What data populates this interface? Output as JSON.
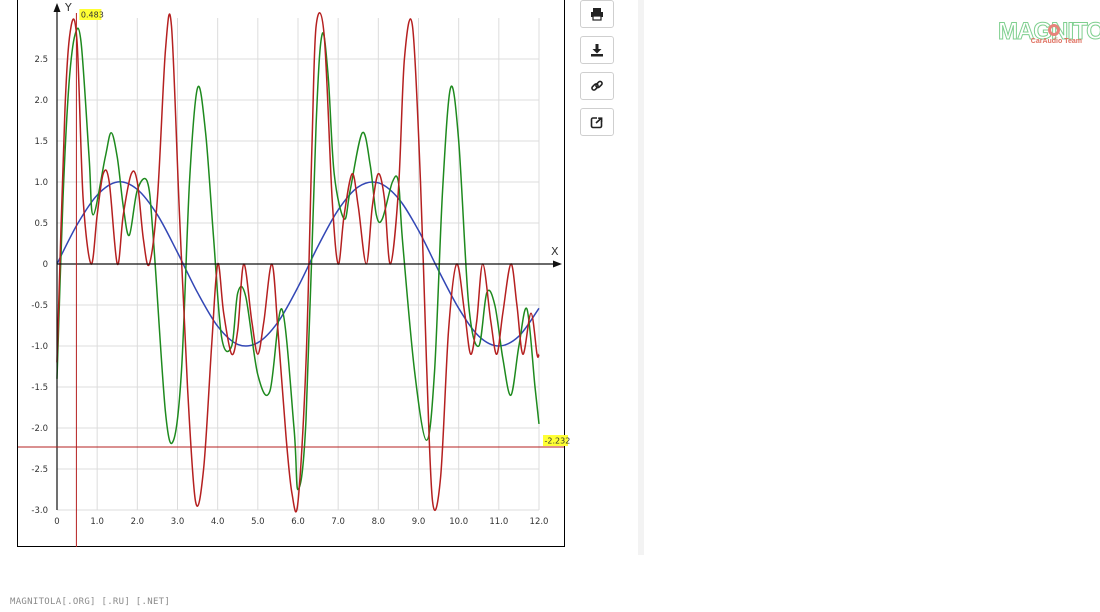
{
  "chart_data": {
    "type": "line",
    "xlabel": "X",
    "ylabel": "Y",
    "xlim": [
      0,
      12
    ],
    "ylim": [
      -3.0,
      3.0
    ],
    "grid": true,
    "x_tick_labels": [
      "0",
      "1.0",
      "2.0",
      "3.0",
      "4.0",
      "5.0",
      "6.0",
      "7.0",
      "8.0",
      "9.0",
      "10.0",
      "11.0",
      "12.0"
    ],
    "y_tick_labels": [
      "2.5",
      "2.0",
      "1.5",
      "1.0",
      "0.5",
      "0",
      "-0.5",
      "-1.0",
      "-1.5",
      "-2.0",
      "-2.5",
      "-3.0"
    ],
    "series": [
      {
        "color": "#3347b5",
        "x": [
          0,
          0.5,
          1,
          1.5,
          2,
          2.5,
          3,
          3.5,
          4,
          4.5,
          5,
          5.5,
          6,
          6.5,
          7,
          7.5,
          8,
          8.5,
          9,
          9.5,
          10,
          10.5,
          11,
          11.5,
          12
        ],
        "values": [
          0,
          0.48,
          0.84,
          1.0,
          0.91,
          0.6,
          0.14,
          -0.35,
          -0.76,
          -0.98,
          -0.96,
          -0.71,
          -0.28,
          0.22,
          0.66,
          0.94,
          0.99,
          0.8,
          0.41,
          -0.08,
          -0.54,
          -0.88,
          -1.0,
          -0.88,
          -0.54
        ]
      },
      {
        "color": "#1e8a1e",
        "x": [
          0,
          0.15,
          0.3,
          0.45,
          0.6,
          0.8,
          0.9,
          1.2,
          1.35,
          1.5,
          1.65,
          1.8,
          2.0,
          2.25,
          2.4,
          2.7,
          2.9,
          3.1,
          3.3,
          3.5,
          3.7,
          3.9,
          4.1,
          4.35,
          4.5,
          4.7,
          5.0,
          5.3,
          5.6,
          5.9,
          6.0,
          6.2,
          6.45,
          6.6,
          6.75,
          6.9,
          7.15,
          7.3,
          7.6,
          7.8,
          7.95,
          8.1,
          8.35,
          8.5,
          8.6,
          8.9,
          9.2,
          9.4,
          9.6,
          9.8,
          10.0,
          10.25,
          10.5,
          10.7,
          10.9,
          11.1,
          11.3,
          11.5,
          11.7,
          11.9,
          12.0
        ],
        "values": [
          -1.4,
          0.8,
          2.2,
          2.8,
          2.7,
          1.3,
          0.6,
          1.3,
          1.6,
          1.3,
          0.7,
          0.35,
          0.9,
          1.0,
          0.3,
          -1.8,
          -2.15,
          -1.3,
          1.0,
          2.15,
          1.6,
          0.3,
          -0.9,
          -1.0,
          -0.35,
          -0.4,
          -1.35,
          -1.55,
          -0.55,
          -2.0,
          -2.75,
          -1.9,
          1.7,
          2.8,
          2.3,
          1.1,
          0.55,
          0.9,
          1.6,
          1.2,
          0.6,
          0.55,
          1.0,
          1.0,
          0.3,
          -1.3,
          -2.15,
          -1.3,
          0.9,
          2.15,
          1.5,
          -0.5,
          -1.0,
          -0.35,
          -0.5,
          -1.15,
          -1.6,
          -1.0,
          -0.55,
          -1.5,
          -1.95
        ]
      },
      {
        "color": "#b52020",
        "x": [
          0,
          0.2,
          0.35,
          0.5,
          0.65,
          0.85,
          1.0,
          1.15,
          1.3,
          1.5,
          1.65,
          1.85,
          2.0,
          2.15,
          2.3,
          2.5,
          2.7,
          2.85,
          3.05,
          3.25,
          3.45,
          3.65,
          3.85,
          4.0,
          4.15,
          4.35,
          4.5,
          4.65,
          4.85,
          5.0,
          5.15,
          5.35,
          5.5,
          5.7,
          5.85,
          6.0,
          6.2,
          6.35,
          6.45,
          6.65,
          6.85,
          7.0,
          7.15,
          7.35,
          7.5,
          7.7,
          7.85,
          8.0,
          8.15,
          8.3,
          8.5,
          8.65,
          8.85,
          9.05,
          9.2,
          9.35,
          9.55,
          9.75,
          9.95,
          10.15,
          10.3,
          10.45,
          10.6,
          10.8,
          10.95,
          11.1,
          11.3,
          11.45,
          11.6,
          11.8,
          11.95,
          12.0
        ],
        "values": [
          -1.2,
          1.9,
          2.9,
          2.7,
          0.8,
          0.0,
          0.6,
          1.1,
          1.0,
          0.0,
          0.6,
          1.1,
          1.0,
          0.3,
          0.0,
          0.8,
          2.6,
          2.9,
          0.6,
          -1.5,
          -2.9,
          -2.5,
          -1.0,
          0.0,
          -0.6,
          -1.1,
          -0.8,
          0.0,
          -0.7,
          -1.1,
          -0.7,
          0.0,
          -0.8,
          -2.1,
          -2.8,
          -2.9,
          -1.2,
          1.5,
          2.9,
          2.8,
          0.8,
          0.0,
          0.6,
          1.1,
          0.7,
          0.0,
          0.7,
          1.1,
          0.8,
          0.0,
          0.9,
          2.5,
          2.9,
          1.0,
          -1.2,
          -2.9,
          -2.6,
          -0.8,
          0.0,
          -0.6,
          -1.1,
          -0.7,
          0.0,
          -0.7,
          -1.1,
          -0.6,
          0.0,
          -0.5,
          -1.1,
          -0.6,
          -1.1,
          -1.1
        ]
      }
    ],
    "crosshair": {
      "x": 0.483,
      "y": -2.232,
      "x_label": "0.483",
      "y_label": "-2.232",
      "color": "#b52020"
    }
  },
  "toolbar": {
    "buttons": [
      {
        "icon": "print-icon",
        "name": "print-button"
      },
      {
        "icon": "download-icon",
        "name": "download-button"
      },
      {
        "icon": "link-icon",
        "name": "link-button"
      },
      {
        "icon": "share-icon",
        "name": "share-button"
      }
    ]
  },
  "logo": {
    "text": "MAGNITOLA",
    "subtext": "CarAudio Team"
  },
  "footer": {
    "text": "MAGNITOLA[.ORG] [.RU] [.NET]"
  }
}
